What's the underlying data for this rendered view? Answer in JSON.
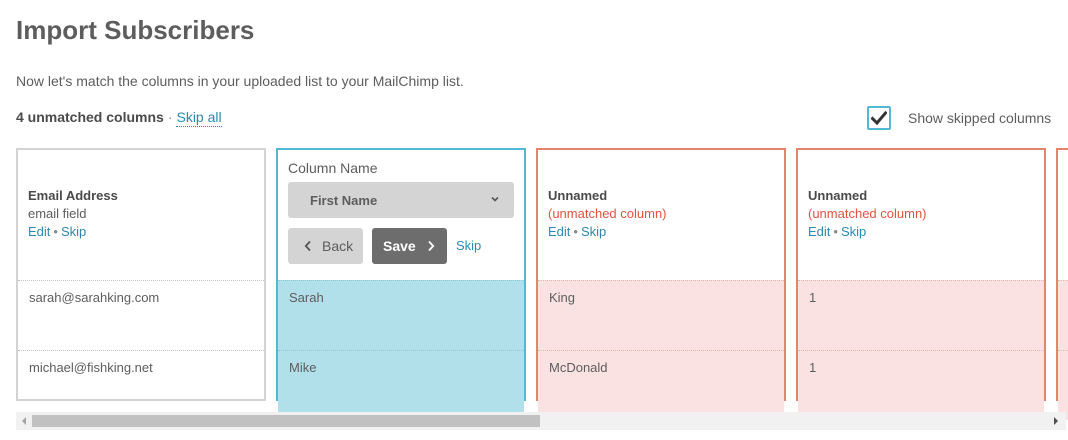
{
  "page": {
    "title": "Import Subscribers",
    "intro": "Now let's match the columns in your uploaded list to your MailChimp list."
  },
  "summary": {
    "unmatched_count": "4 unmatched columns",
    "separator": "·",
    "skip_all": "Skip all"
  },
  "show_skipped": {
    "checked": true,
    "label": "Show skipped columns"
  },
  "columns": {
    "email": {
      "name": "Email Address",
      "subtitle": "email field",
      "edit": "Edit",
      "dot": "•",
      "skip": "Skip",
      "cells": [
        "sarah@sarahking.com",
        "michael@fishking.net"
      ]
    },
    "active": {
      "label": "Column Name",
      "selected": "First Name",
      "back": "Back",
      "save": "Save",
      "skip": "Skip",
      "cells": [
        "Sarah",
        "Mike"
      ]
    },
    "unmatched": [
      {
        "name": "Unnamed",
        "subtitle": "(unmatched column)",
        "edit": "Edit",
        "dot": "•",
        "skip": "Skip",
        "cells": [
          "King",
          "McDonald"
        ]
      },
      {
        "name": "Unnamed",
        "subtitle": "(unmatched column)",
        "edit": "Edit",
        "dot": "•",
        "skip": "Skip",
        "cells": [
          "1",
          "1"
        ]
      }
    ]
  },
  "colors": {
    "accent": "#52b8d6",
    "link": "#2a8ab3",
    "unmatched_border": "#e3856a",
    "unmatched_text": "#e0543d",
    "active_cell_bg": "#b2e0ea",
    "unmatched_cell_bg": "#fbe2e2"
  },
  "icons": {
    "checkbox": "checkmark-icon",
    "select": "chevron-down-icon",
    "back": "chevron-left-icon",
    "save": "chevron-right-icon"
  }
}
